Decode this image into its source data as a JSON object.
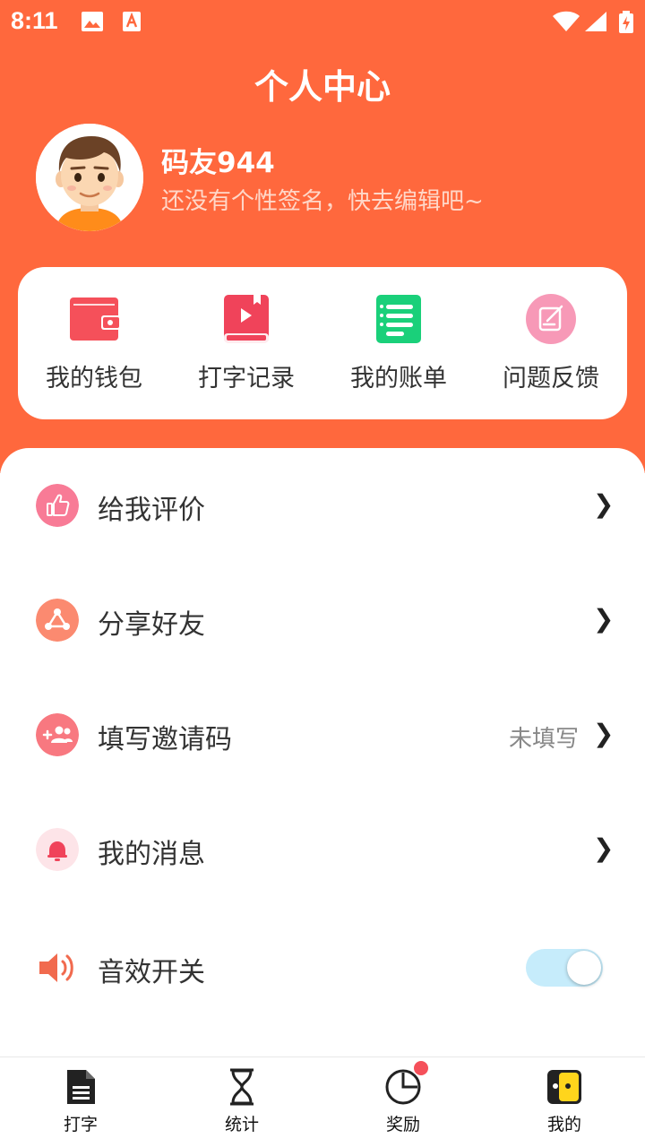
{
  "status_bar": {
    "time": "8:11"
  },
  "header": {
    "title": "个人中心"
  },
  "profile": {
    "username": "码友944",
    "signature": "还没有个性签名，快去编辑吧~"
  },
  "quick_actions": [
    {
      "label": "我的钱包",
      "icon": "wallet-icon",
      "color": "#f5505a"
    },
    {
      "label": "打字记录",
      "icon": "typing-record-icon",
      "color": "#f0435a"
    },
    {
      "label": "我的账单",
      "icon": "bill-icon",
      "color": "#1ad07a"
    },
    {
      "label": "问题反馈",
      "icon": "feedback-icon",
      "color": "#f799b7"
    }
  ],
  "menu": [
    {
      "label": "给我评价",
      "icon": "thumbs-up-icon",
      "value": ""
    },
    {
      "label": "分享好友",
      "icon": "share-icon",
      "value": ""
    },
    {
      "label": "填写邀请码",
      "icon": "invite-icon",
      "value": "未填写"
    },
    {
      "label": "我的消息",
      "icon": "bell-icon",
      "value": ""
    },
    {
      "label": "音效开关",
      "icon": "speaker-icon",
      "toggle_on": true
    }
  ],
  "tabs": [
    {
      "label": "打字",
      "icon": "document-icon",
      "badge": false
    },
    {
      "label": "统计",
      "icon": "hourglass-icon",
      "badge": false
    },
    {
      "label": "奖励",
      "icon": "pie-clock-icon",
      "badge": true
    },
    {
      "label": "我的",
      "icon": "face-icon",
      "badge": false,
      "active": true
    }
  ],
  "colors": {
    "brand": "#ff683d",
    "toggle_track": "#c6ecfb",
    "badge": "#f5505a"
  }
}
